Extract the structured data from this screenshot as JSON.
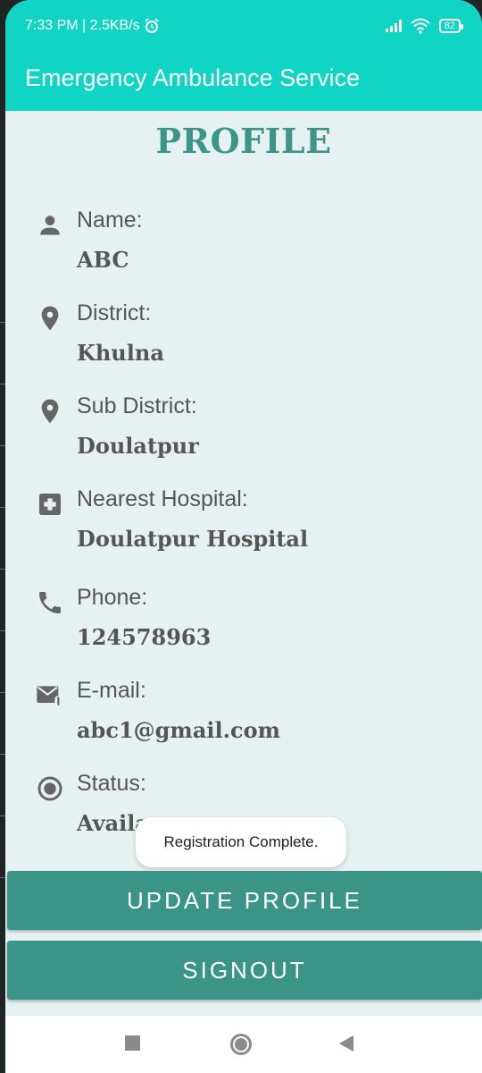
{
  "status_bar": {
    "time_speed": "7:33 PM | 2.5KB/s",
    "battery": "82"
  },
  "app_bar": {
    "title": "Emergency Ambulance Service"
  },
  "page": {
    "title": "PROFILE"
  },
  "profile": [
    {
      "label": "Name:",
      "value": "ABC",
      "icon": "person-icon"
    },
    {
      "label": "District:",
      "value": "Khulna",
      "icon": "location-pin-icon"
    },
    {
      "label": "Sub District:",
      "value": "Doulatpur",
      "icon": "location-pin-icon"
    },
    {
      "label": "Nearest Hospital:",
      "value": "Doulatpur Hospital",
      "icon": "hospital-cross-icon"
    },
    {
      "label": "Phone:",
      "value": "124578963",
      "icon": "phone-icon"
    },
    {
      "label": "E-mail:",
      "value": "abc1@gmail.com",
      "icon": "mail-attachment-icon"
    },
    {
      "label": "Status:",
      "value": "Availa",
      "icon": "radio-button-icon"
    }
  ],
  "toast": {
    "text": "Registration Complete."
  },
  "buttons": {
    "update": "UPDATE PROFILE",
    "signout": "SIGNOUT"
  },
  "colors": {
    "accent": "#11d5c4",
    "button": "#3a9488",
    "title": "#3c9688",
    "background": "#e6f2f1"
  }
}
